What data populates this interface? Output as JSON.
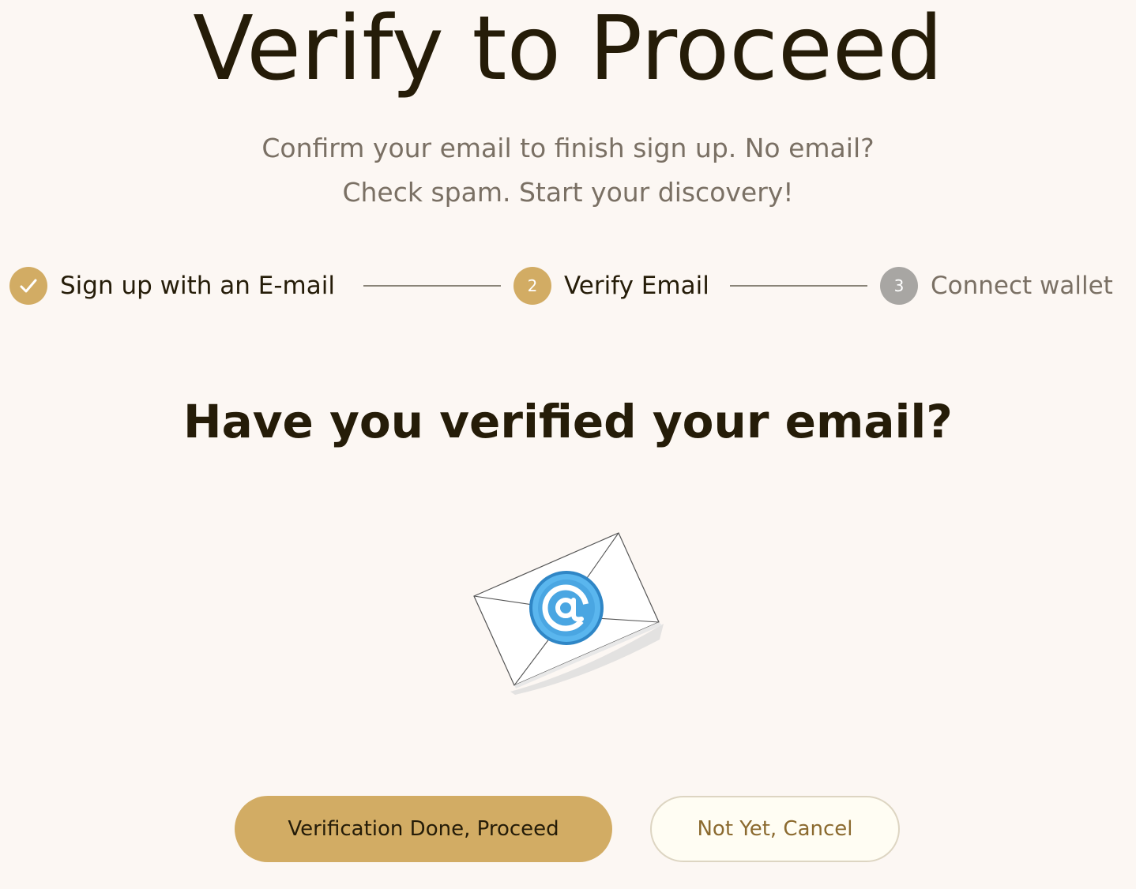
{
  "header": {
    "title": "Verify to Proceed",
    "subtitle_line1": "Confirm your email to finish sign up. No email?",
    "subtitle_line2": "Check spam. Start your discovery!"
  },
  "stepper": {
    "steps": [
      {
        "label": "Sign up with an E-mail",
        "status": "completed",
        "icon": "check-icon"
      },
      {
        "number": "2",
        "label": "Verify Email",
        "status": "active"
      },
      {
        "number": "3",
        "label": "Connect wallet",
        "status": "upcoming"
      }
    ]
  },
  "main": {
    "question": "Have you verified your email?",
    "illustration": "email-envelope-icon"
  },
  "actions": {
    "proceed_label": "Verification Done, Proceed",
    "cancel_label": "Not Yet, Cancel"
  },
  "colors": {
    "background": "#fcf7f3",
    "accent": "#d2ac64",
    "text_dark": "#251c08",
    "text_muted": "#7a7064",
    "step_inactive": "#a8a6a3",
    "secondary_text": "#8b6a2f"
  }
}
